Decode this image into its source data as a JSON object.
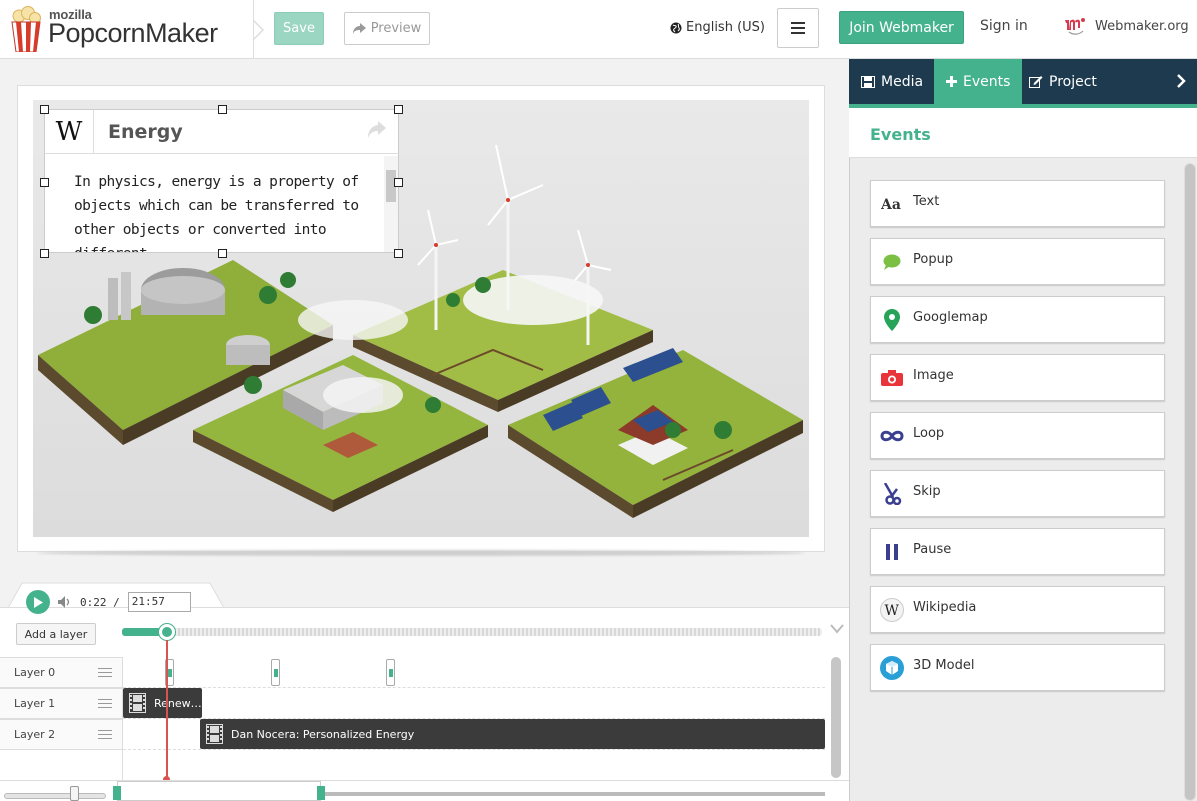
{
  "header": {
    "logo_small": "mozilla",
    "logo_big": "PopcornMaker",
    "save_label": "Save",
    "preview_label": "Preview",
    "language_label": "English (US)",
    "join_label": "Join Webmaker",
    "signin_label": "Sign in",
    "webmaker_label": "Webmaker.org"
  },
  "stage": {
    "wikipedia": {
      "title": "Energy",
      "text": "In physics, energy is a property of objects which can be transferred to other objects or converted into different"
    }
  },
  "timeline": {
    "current_time": "0:22 /",
    "duration": "21:57",
    "add_layer_label": "Add a layer",
    "layers": [
      {
        "label": "Layer 0"
      },
      {
        "label": "Layer 1"
      },
      {
        "label": "Layer 2"
      }
    ],
    "clips": {
      "layer1": "Renew…",
      "layer2": "Dan Nocera: Personalized Energy"
    }
  },
  "panel": {
    "tabs": [
      {
        "label": "Media"
      },
      {
        "label": "Events"
      },
      {
        "label": "Project"
      }
    ],
    "active_tab": "Events",
    "title": "Events",
    "events": [
      {
        "label": "Text",
        "icon": "text-icon"
      },
      {
        "label": "Popup",
        "icon": "speech-bubble-icon"
      },
      {
        "label": "Googlemap",
        "icon": "map-pin-icon"
      },
      {
        "label": "Image",
        "icon": "camera-icon"
      },
      {
        "label": "Loop",
        "icon": "loop-icon"
      },
      {
        "label": "Skip",
        "icon": "scissors-icon"
      },
      {
        "label": "Pause",
        "icon": "pause-icon"
      },
      {
        "label": "Wikipedia",
        "icon": "wikipedia-icon"
      },
      {
        "label": "3D Model",
        "icon": "cube-icon"
      }
    ]
  },
  "colors": {
    "accent": "#45b28e",
    "panel_tabs": "#1d3a4f",
    "playhead": "#d9534f"
  }
}
